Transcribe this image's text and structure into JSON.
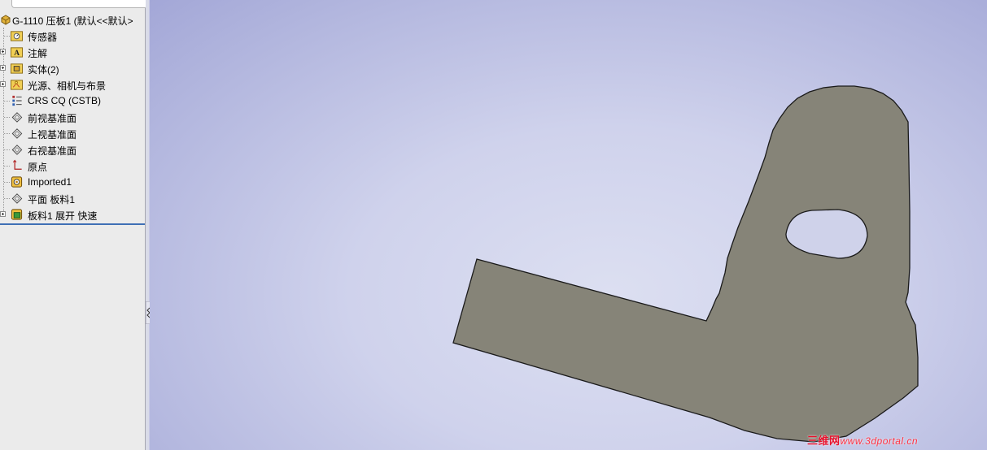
{
  "feature_tree": {
    "root_label": "G-1110 压板1  (默认<<默认>",
    "items": [
      {
        "label": "传感器",
        "icon": "sensor-folder-icon",
        "expandable": false
      },
      {
        "label": "注解",
        "icon": "annotation-folder-icon",
        "expandable": true
      },
      {
        "label": "实体(2)",
        "icon": "solid-bodies-folder-icon",
        "expandable": true
      },
      {
        "label": "光源、相机与布景",
        "icon": "lights-cameras-folder-icon",
        "expandable": true
      },
      {
        "label": "CRS CQ (CSTB)",
        "icon": "material-icon",
        "expandable": false
      },
      {
        "label": "前视基准面",
        "icon": "plane-icon",
        "expandable": false
      },
      {
        "label": "上视基准面",
        "icon": "plane-icon",
        "expandable": false
      },
      {
        "label": "右视基准面",
        "icon": "plane-icon",
        "expandable": false
      },
      {
        "label": "原点",
        "icon": "origin-icon",
        "expandable": false
      },
      {
        "label": "Imported1",
        "icon": "imported-feature-icon",
        "expandable": false
      },
      {
        "label": "平面 板料1",
        "icon": "plane-icon",
        "expandable": false
      },
      {
        "label": "板料1 展开 快速",
        "icon": "flat-pattern-icon",
        "expandable": true
      }
    ]
  },
  "viewport": {
    "part_color": "#868478",
    "background_color": "#c9cbe6"
  },
  "watermark": {
    "prefix": "三维网",
    "site": "www.3dportal.cn"
  }
}
